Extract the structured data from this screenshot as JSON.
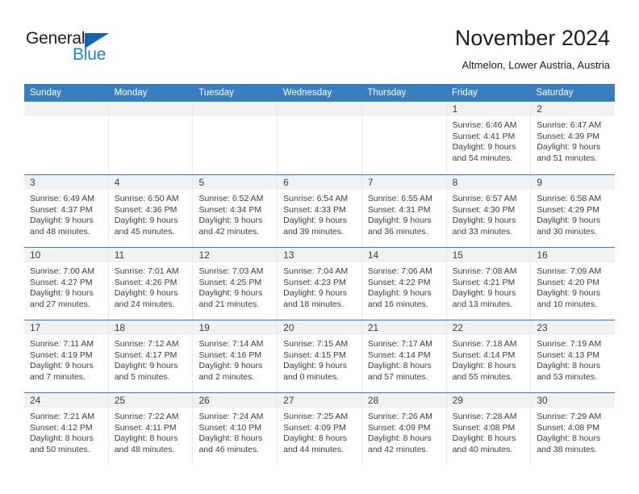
{
  "brand": {
    "name_top": "General",
    "name_bottom": "Blue",
    "triangle_color": "#1562ad",
    "blue_color": "#1f7fd0"
  },
  "header": {
    "title": "November 2024",
    "location": "Altmelon, Lower Austria, Austria"
  },
  "theme": {
    "header_blue": "#3a7ebf",
    "daynum_band": "#f1f1f1",
    "text": "#3c3c3c"
  },
  "weekdays": [
    "Sunday",
    "Monday",
    "Tuesday",
    "Wednesday",
    "Thursday",
    "Friday",
    "Saturday"
  ],
  "weeks": [
    [
      {
        "day": "",
        "lines": []
      },
      {
        "day": "",
        "lines": []
      },
      {
        "day": "",
        "lines": []
      },
      {
        "day": "",
        "lines": []
      },
      {
        "day": "",
        "lines": []
      },
      {
        "day": "1",
        "lines": [
          "Sunrise: 6:46 AM",
          "Sunset: 4:41 PM",
          "Daylight: 9 hours",
          "and 54 minutes."
        ]
      },
      {
        "day": "2",
        "lines": [
          "Sunrise: 6:47 AM",
          "Sunset: 4:39 PM",
          "Daylight: 9 hours",
          "and 51 minutes."
        ]
      }
    ],
    [
      {
        "day": "3",
        "lines": [
          "Sunrise: 6:49 AM",
          "Sunset: 4:37 PM",
          "Daylight: 9 hours",
          "and 48 minutes."
        ]
      },
      {
        "day": "4",
        "lines": [
          "Sunrise: 6:50 AM",
          "Sunset: 4:36 PM",
          "Daylight: 9 hours",
          "and 45 minutes."
        ]
      },
      {
        "day": "5",
        "lines": [
          "Sunrise: 6:52 AM",
          "Sunset: 4:34 PM",
          "Daylight: 9 hours",
          "and 42 minutes."
        ]
      },
      {
        "day": "6",
        "lines": [
          "Sunrise: 6:54 AM",
          "Sunset: 4:33 PM",
          "Daylight: 9 hours",
          "and 39 minutes."
        ]
      },
      {
        "day": "7",
        "lines": [
          "Sunrise: 6:55 AM",
          "Sunset: 4:31 PM",
          "Daylight: 9 hours",
          "and 36 minutes."
        ]
      },
      {
        "day": "8",
        "lines": [
          "Sunrise: 6:57 AM",
          "Sunset: 4:30 PM",
          "Daylight: 9 hours",
          "and 33 minutes."
        ]
      },
      {
        "day": "9",
        "lines": [
          "Sunrise: 6:58 AM",
          "Sunset: 4:29 PM",
          "Daylight: 9 hours",
          "and 30 minutes."
        ]
      }
    ],
    [
      {
        "day": "10",
        "lines": [
          "Sunrise: 7:00 AM",
          "Sunset: 4:27 PM",
          "Daylight: 9 hours",
          "and 27 minutes."
        ]
      },
      {
        "day": "11",
        "lines": [
          "Sunrise: 7:01 AM",
          "Sunset: 4:26 PM",
          "Daylight: 9 hours",
          "and 24 minutes."
        ]
      },
      {
        "day": "12",
        "lines": [
          "Sunrise: 7:03 AM",
          "Sunset: 4:25 PM",
          "Daylight: 9 hours",
          "and 21 minutes."
        ]
      },
      {
        "day": "13",
        "lines": [
          "Sunrise: 7:04 AM",
          "Sunset: 4:23 PM",
          "Daylight: 9 hours",
          "and 18 minutes."
        ]
      },
      {
        "day": "14",
        "lines": [
          "Sunrise: 7:06 AM",
          "Sunset: 4:22 PM",
          "Daylight: 9 hours",
          "and 16 minutes."
        ]
      },
      {
        "day": "15",
        "lines": [
          "Sunrise: 7:08 AM",
          "Sunset: 4:21 PM",
          "Daylight: 9 hours",
          "and 13 minutes."
        ]
      },
      {
        "day": "16",
        "lines": [
          "Sunrise: 7:09 AM",
          "Sunset: 4:20 PM",
          "Daylight: 9 hours",
          "and 10 minutes."
        ]
      }
    ],
    [
      {
        "day": "17",
        "lines": [
          "Sunrise: 7:11 AM",
          "Sunset: 4:19 PM",
          "Daylight: 9 hours",
          "and 7 minutes."
        ]
      },
      {
        "day": "18",
        "lines": [
          "Sunrise: 7:12 AM",
          "Sunset: 4:17 PM",
          "Daylight: 9 hours",
          "and 5 minutes."
        ]
      },
      {
        "day": "19",
        "lines": [
          "Sunrise: 7:14 AM",
          "Sunset: 4:16 PM",
          "Daylight: 9 hours",
          "and 2 minutes."
        ]
      },
      {
        "day": "20",
        "lines": [
          "Sunrise: 7:15 AM",
          "Sunset: 4:15 PM",
          "Daylight: 9 hours",
          "and 0 minutes."
        ]
      },
      {
        "day": "21",
        "lines": [
          "Sunrise: 7:17 AM",
          "Sunset: 4:14 PM",
          "Daylight: 8 hours",
          "and 57 minutes."
        ]
      },
      {
        "day": "22",
        "lines": [
          "Sunrise: 7:18 AM",
          "Sunset: 4:14 PM",
          "Daylight: 8 hours",
          "and 55 minutes."
        ]
      },
      {
        "day": "23",
        "lines": [
          "Sunrise: 7:19 AM",
          "Sunset: 4:13 PM",
          "Daylight: 8 hours",
          "and 53 minutes."
        ]
      }
    ],
    [
      {
        "day": "24",
        "lines": [
          "Sunrise: 7:21 AM",
          "Sunset: 4:12 PM",
          "Daylight: 8 hours",
          "and 50 minutes."
        ]
      },
      {
        "day": "25",
        "lines": [
          "Sunrise: 7:22 AM",
          "Sunset: 4:11 PM",
          "Daylight: 8 hours",
          "and 48 minutes."
        ]
      },
      {
        "day": "26",
        "lines": [
          "Sunrise: 7:24 AM",
          "Sunset: 4:10 PM",
          "Daylight: 8 hours",
          "and 46 minutes."
        ]
      },
      {
        "day": "27",
        "lines": [
          "Sunrise: 7:25 AM",
          "Sunset: 4:09 PM",
          "Daylight: 8 hours",
          "and 44 minutes."
        ]
      },
      {
        "day": "28",
        "lines": [
          "Sunrise: 7:26 AM",
          "Sunset: 4:09 PM",
          "Daylight: 8 hours",
          "and 42 minutes."
        ]
      },
      {
        "day": "29",
        "lines": [
          "Sunrise: 7:28 AM",
          "Sunset: 4:08 PM",
          "Daylight: 8 hours",
          "and 40 minutes."
        ]
      },
      {
        "day": "30",
        "lines": [
          "Sunrise: 7:29 AM",
          "Sunset: 4:08 PM",
          "Daylight: 8 hours",
          "and 38 minutes."
        ]
      }
    ]
  ]
}
